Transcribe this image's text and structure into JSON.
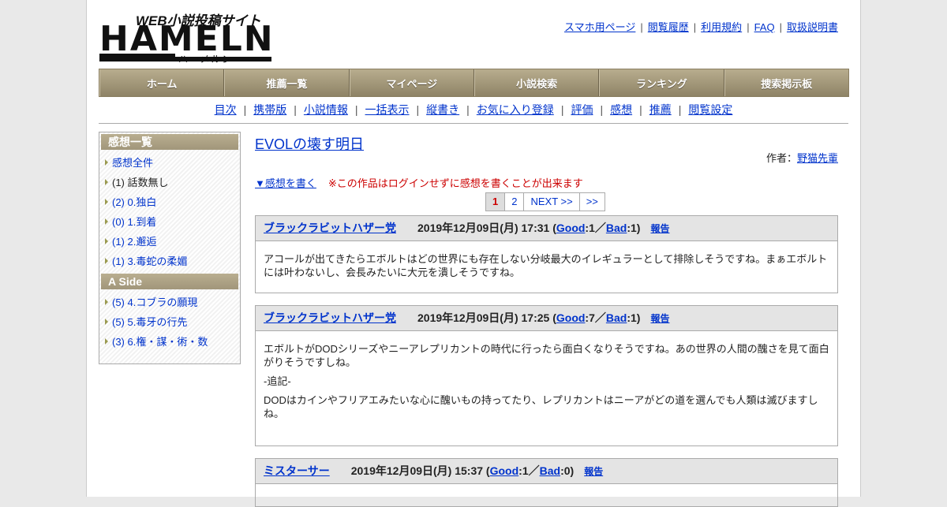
{
  "logo": {
    "tagline": "WEB小説投稿サイト",
    "name": "HAMELN",
    "kana": "ハーメルン"
  },
  "top_links": [
    "スマホ用ページ",
    "閲覧履歴",
    "利用規約",
    "FAQ",
    "取扱説明書"
  ],
  "nav": [
    "ホーム",
    "推薦一覧",
    "マイページ",
    "小説検索",
    "ランキング",
    "捜索掲示板"
  ],
  "subnav": [
    "目次",
    "携帯版",
    "小説情報",
    "一括表示",
    "縦書き",
    "お気に入り登録",
    "評価",
    "感想",
    "推薦",
    "閲覧設定"
  ],
  "sidebar": {
    "header1": "感想一覧",
    "items1": [
      {
        "label": "感想全件",
        "link": true
      },
      {
        "label": "(1) 話数無し",
        "link": false
      },
      {
        "label": "(2) 0.独白",
        "link": true
      },
      {
        "label": "(0) 1.到着",
        "link": true
      },
      {
        "label": "(1) 2.邂逅",
        "link": true
      },
      {
        "label": "(1) 3.毒蛇の柔媚",
        "link": true
      }
    ],
    "header2": "A Side",
    "items2": [
      {
        "label": "(5) 4.コブラの願現",
        "link": true
      },
      {
        "label": "(5) 5.毒牙の行先",
        "link": true
      },
      {
        "label": "(3) 6.権・謀・術・数",
        "link": true
      }
    ]
  },
  "main": {
    "title": "EVOLの壊す明日",
    "author_label": "作者：",
    "author": "野猫先輩",
    "write_link": "▼感想を書く",
    "warning": "※この作品はログインせずに感想を書くことが出来ます",
    "pager": [
      "1",
      "2",
      "NEXT >>",
      ">>"
    ],
    "comments": [
      {
        "name": "ブラックラビットハザー党",
        "date": "2019年12月09日(月) 17:31",
        "good_label": "Good",
        "good": ":1／",
        "bad_label": "Bad",
        "bad": ":1)",
        "report": "報告",
        "paragraphs": [
          "アコールが出てきたらエボルトはどの世界にも存在しない分岐最大のイレギュラーとして排除しそうですね。まぁエボルトには叶わないし、会長みたいに大元を潰しそうですね。"
        ]
      },
      {
        "name": "ブラックラビットハザー党",
        "date": "2019年12月09日(月) 17:25",
        "good_label": "Good",
        "good": ":7／",
        "bad_label": "Bad",
        "bad": ":1)",
        "report": "報告",
        "paragraphs": [
          "エボルトがDODシリーズやニーアレプリカントの時代に行ったら面白くなりそうですね。あの世界の人間の醜さを見て面白がりそうですしね。",
          "-追記-",
          "DODはカインやフリアエみたいな心に醜いもの持ってたり、レプリカントはニーアがどの道を選んでも人類は滅びますしね。"
        ]
      },
      {
        "name": "ミスターサー",
        "date": "2019年12月09日(月) 15:37",
        "good_label": "Good",
        "good": ":1／",
        "bad_label": "Bad",
        "bad": ":0)",
        "report": "報告",
        "paragraphs": []
      }
    ]
  }
}
